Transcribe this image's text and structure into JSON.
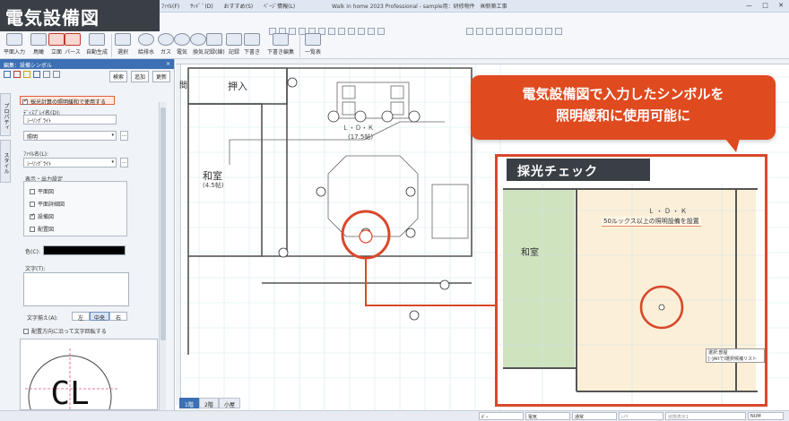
{
  "window": {
    "title": "Walk in home 2023 Professional - sample用：研修物件　㈱新築工事",
    "menus": [
      "ﾌｧｲﾙ(F)",
      "ｻｯﾄﾞ ﾞ(D)",
      "おすすめ(S)",
      "ﾍﾟｰｼﾞ情報(L)"
    ],
    "controls": [
      "—",
      "□",
      "✕"
    ]
  },
  "feature_title": "電気設備図",
  "ribbon": {
    "buttons": [
      "平面入力",
      "鳥瞰",
      "立面",
      "パース",
      "自動生成",
      "選択",
      "給排水",
      "ガス",
      "電気",
      "換気",
      "記録(線)",
      "記録",
      "下書き",
      "下書き編集",
      "一覧表"
    ]
  },
  "panel": {
    "header": "編集：設備シンボル",
    "close": "×",
    "buttons": {
      "search": "検索",
      "append": "追加",
      "change": "更新"
    },
    "vtabs": [
      "プロパティ",
      "スタイル"
    ],
    "lighting_check_label": "採光計算の照明緩和で使用する",
    "display_name_label": "ﾃﾞｨｽﾌﾟﾚｲ名(D):",
    "display_name_value": "ｼｰﾘﾝｸﾞﾗｲﾄ",
    "type_value": "照明",
    "file_label": "ﾌｧｲﾙ名(L):",
    "file_value": "ｼｰﾘﾝｸﾞﾗｲﾄ",
    "display_settings_label": "表示・出力設定",
    "display_options": [
      {
        "label": "平面図",
        "checked": false
      },
      {
        "label": "平面詳細図",
        "checked": false
      },
      {
        "label": "設備図",
        "checked": true
      },
      {
        "label": "配置図",
        "checked": false
      }
    ],
    "color_label": "色(C):",
    "color_value": "#000000",
    "text_label": "文字(T):",
    "align_label": "文字揃え(A):",
    "align_options": [
      "左",
      "中央",
      "右"
    ],
    "align_selected": "中央",
    "rotate_label": "配置方向に沿って文字回転する",
    "preview_text": "CL"
  },
  "plan": {
    "room_oshiire": "押入",
    "room_washitsu": "和室",
    "washitsu_size": "(4.5帖)",
    "ldk": "Ｌ・Ｄ・Ｋ",
    "ldk_size": "(17.5帖)",
    "ma": "間"
  },
  "callout": {
    "line1": "電気設備図で入力したシンボルを",
    "line2": "照明緩和に使用可能に"
  },
  "inset": {
    "title": "採光チェック",
    "washitsu": "和室",
    "ldk": "Ｌ・Ｄ・Ｋ",
    "lux_note": "50ルックス以上の照明設備を設置",
    "tooltip_line1": "選択:部屋",
    "tooltip_line2": "[-]AltでI選択候補リスト"
  },
  "floor_tabs": [
    "1階",
    "2階",
    "小屋"
  ],
  "floor_selected": "1階",
  "status": [
    "ｶﾞｰ",
    "電気",
    "通常",
    "ﾚｲﾔ",
    "状態表示1",
    "NUM"
  ],
  "colors": {
    "accent": "#e04a1f",
    "panel_head": "#3c6fb4",
    "dark_title": "#3a3f46"
  }
}
